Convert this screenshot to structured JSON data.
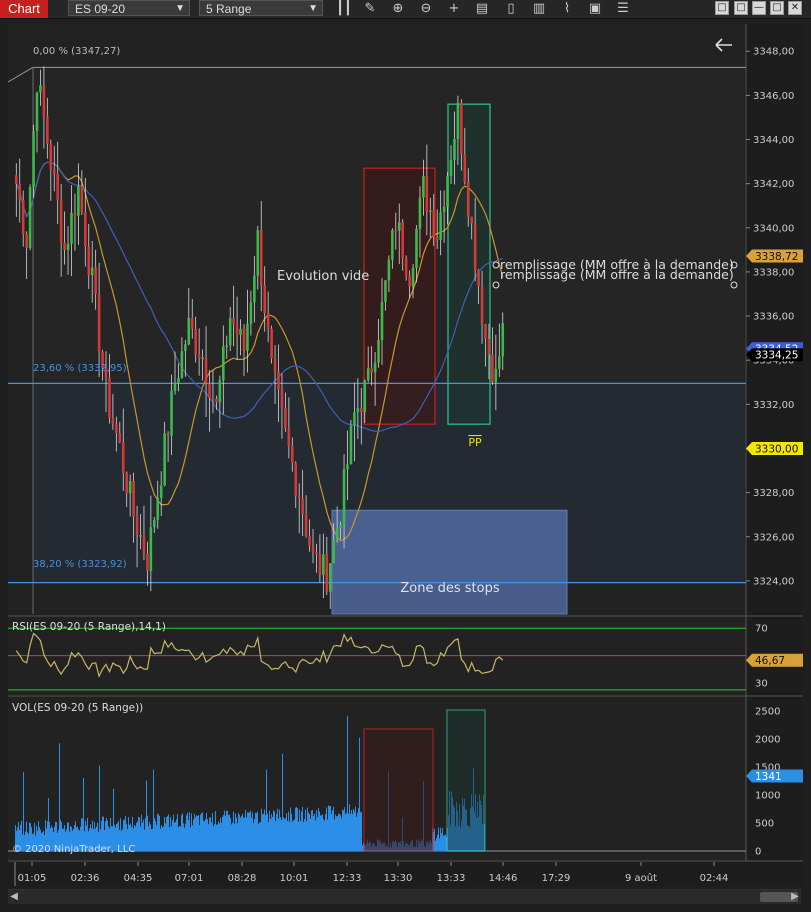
{
  "toolbar": {
    "chart_tab": "Chart",
    "instrument": "ES 09-20",
    "period": "5 Range",
    "icons": [
      "bar-type-icon",
      "pencil-icon",
      "zoom-in-icon",
      "zoom-out-icon",
      "crosshair-icon",
      "data-box-icon",
      "properties-icon",
      "indicators-icon",
      "strategies-icon",
      "snapshot-icon",
      "list-icon"
    ]
  },
  "window_buttons": {
    "restore": "□",
    "restore2": "□",
    "minimize": "—",
    "maximize": "□",
    "close": "✕"
  },
  "colors": {
    "up": "#3cb94a",
    "down": "#d23a3a",
    "fib": "#4a8fe0",
    "sma_orange": "#c8962f",
    "sma_blue": "#3f5fb8",
    "rsi": "#c9b56a",
    "volume": "#2b8fe8",
    "red_box": "#dd2222",
    "green_box": "#33dd99"
  },
  "chart_data": [
    {
      "type": "candlestick",
      "title": "",
      "xlabel": "",
      "ylabel": "",
      "ylim": [
        3322.5,
        3348.6
      ],
      "yticks": [
        "3348,00",
        "3346,00",
        "3344,00",
        "3342,00",
        "3340,00",
        "3338,00",
        "3336,00",
        "3334,00",
        "3332,00",
        "3330,00",
        "3328,00",
        "3326,00",
        "3324,00"
      ],
      "ytick_values": [
        3348,
        3346,
        3344,
        3342,
        3340,
        3338,
        3336,
        3334,
        3332,
        3330,
        3328,
        3326,
        3324
      ],
      "xticks": [
        "01:05",
        "02:36",
        "04:35",
        "07:01",
        "08:28",
        "10:01",
        "12:33",
        "13:30",
        "13:33",
        "14:46",
        "17:29",
        "9 août",
        "02:44"
      ],
      "price_path": [
        [
          0,
          3342
        ],
        [
          3,
          3339.5
        ],
        [
          6,
          3346.8
        ],
        [
          10,
          3343
        ],
        [
          14,
          3339
        ],
        [
          18,
          3341.8
        ],
        [
          22,
          3337.5
        ],
        [
          26,
          3332.5
        ],
        [
          30,
          3330
        ],
        [
          34,
          3327
        ],
        [
          38,
          3325
        ],
        [
          42,
          3329
        ],
        [
          46,
          3333
        ],
        [
          50,
          3335.5
        ],
        [
          54,
          3334.2
        ],
        [
          58,
          3331.8
        ],
        [
          62,
          3336
        ],
        [
          66,
          3334.5
        ],
        [
          70,
          3339.5
        ],
        [
          74,
          3333.5
        ],
        [
          78,
          3330.5
        ],
        [
          82,
          3328
        ],
        [
          86,
          3325
        ],
        [
          90,
          3324.3
        ],
        [
          94,
          3327.2
        ],
        [
          98,
          3331.5
        ],
        [
          102,
          3333
        ],
        [
          106,
          3336.3
        ],
        [
          110,
          3340.3
        ],
        [
          114,
          3338
        ],
        [
          118,
          3341.8
        ],
        [
          122,
          3339.8
        ],
        [
          126,
          3343.5
        ],
        [
          128,
          3345.2
        ],
        [
          132,
          3340
        ],
        [
          136,
          3335
        ],
        [
          139,
          3333.2
        ],
        [
          141,
          3335.3
        ]
      ],
      "current_price": "3334,25",
      "sma_orange_value": "3338,72",
      "sma_blue_value": "3334,52",
      "pp_value": "3330,00",
      "fib_levels": [
        {
          "label": "0,00 % (3347,27)",
          "value": 3347.27
        },
        {
          "label": "23,60 % (3332,95)",
          "value": 3332.95
        },
        {
          "label": "38,20 % (3323,92)",
          "value": 3323.92
        }
      ],
      "annotations": {
        "evolution": "Evolution vide",
        "remplissage1": "remplissage (MM offre à la demande)",
        "remplissage2": "remplissage (MM offre à la demande)",
        "zone_stops": "Zone des stops",
        "pp": "PP"
      },
      "zone_stops": {
        "price_top": 3327.2,
        "price_bottom": 3322.5
      },
      "red_box": {
        "price_top": 3342.7,
        "price_bottom": 3331.1
      },
      "green_box": {
        "price_top": 3345.6,
        "price_bottom": 3331.1
      }
    },
    {
      "type": "line",
      "title": "RSI(ES 09-20 (5 Range),14,1)",
      "ylim": [
        22,
        76
      ],
      "yticks": [
        "70",
        "30"
      ],
      "ytick_values": [
        70,
        30
      ],
      "levels": {
        "upper": 70,
        "middle": 50,
        "lower": 25
      },
      "current_value": "46,67"
    },
    {
      "type": "bar",
      "title": "VOL(ES 09-20 (5 Range))",
      "ylim": [
        0,
        2700
      ],
      "yticks": [
        "2500",
        "2000",
        "1500",
        "1000",
        "500",
        "0"
      ],
      "ytick_values": [
        2500,
        2000,
        1500,
        1000,
        500,
        0
      ],
      "current_value": "1341"
    }
  ],
  "copyright": "© 2020 NinjaTrader, LLC"
}
